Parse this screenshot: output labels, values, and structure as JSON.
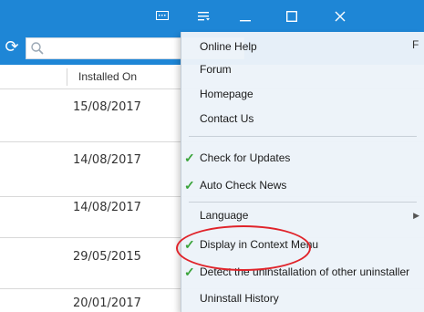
{
  "header": {
    "column_installed_on": "Installed On"
  },
  "rows": [
    {
      "date": "15/08/2017"
    },
    {
      "date": "14/08/2017"
    },
    {
      "date": "14/08/2017"
    },
    {
      "date": "29/05/2015"
    },
    {
      "date": "20/01/2017"
    }
  ],
  "menu": {
    "items": [
      {
        "label": "Online Help",
        "checked": false
      },
      {
        "label": "Forum",
        "checked": false
      },
      {
        "label": "Homepage",
        "checked": false
      },
      {
        "label": "Contact Us",
        "checked": false
      },
      {
        "label": "Check for Updates",
        "checked": true
      },
      {
        "label": "Auto Check News",
        "checked": true
      },
      {
        "label": "Language",
        "checked": false,
        "submenu": true
      },
      {
        "label": "Display in Context Menu",
        "checked": true
      },
      {
        "label": "Detect the uninstallation of other uninstaller",
        "checked": true
      },
      {
        "label": "Uninstall History",
        "checked": false
      }
    ],
    "check_glyph": "✓",
    "submenu_glyph": "▶",
    "clipped_text": "F"
  },
  "colors": {
    "titlebar": "#1e86d6",
    "check": "#3aa33a",
    "annotation": "#e0232a"
  },
  "icons": [
    "feedback-icon",
    "menu-icon",
    "minimize-icon",
    "maximize-icon",
    "close-icon",
    "refresh-icon",
    "search-icon"
  ]
}
